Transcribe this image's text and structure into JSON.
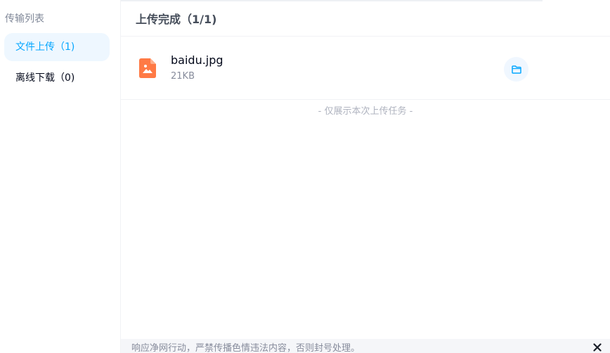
{
  "sidebar": {
    "title": "传输列表",
    "items": [
      {
        "label": "文件上传（1)",
        "active": true
      },
      {
        "label": "离线下载（0)",
        "active": false
      }
    ]
  },
  "main": {
    "title": "上传完成（1/1)",
    "files": [
      {
        "name": "baidu.jpg",
        "size": "21KB",
        "icon": "image-file-icon"
      }
    ],
    "note": "- 仅展示本次上传任务 -"
  },
  "footer": {
    "text": "响应净网行动，严禁传播色情违法内容，否则封号处理。",
    "close_icon": "close-icon"
  },
  "colors": {
    "accent": "#06a7ff",
    "active_bg": "#eef7ff",
    "file_icon": "#ff7a45",
    "muted_text": "#878c9c",
    "note_text": "#afb3bf"
  }
}
